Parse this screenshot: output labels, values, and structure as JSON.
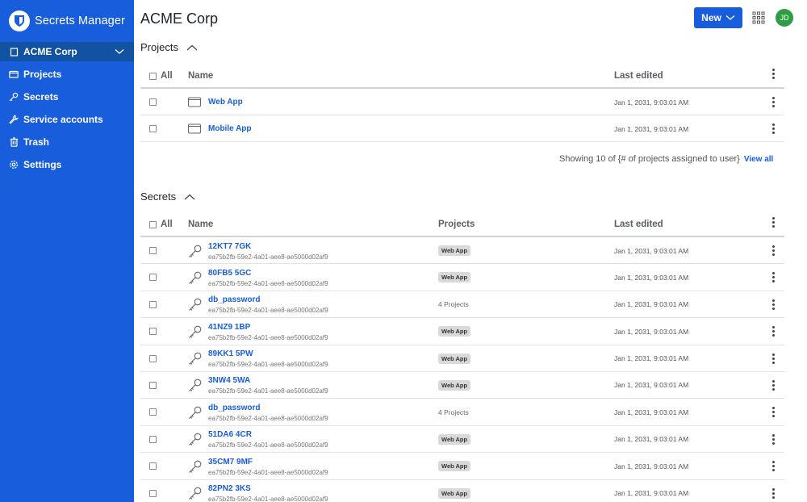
{
  "sidebar": {
    "brand": "Secrets Manager",
    "org": "ACME Corp",
    "nav": [
      {
        "label": "Projects",
        "icon": "folder-icon"
      },
      {
        "label": "Secrets",
        "icon": "key-icon"
      },
      {
        "label": "Service accounts",
        "icon": "wrench-icon"
      },
      {
        "label": "Trash",
        "icon": "trash-icon"
      },
      {
        "label": "Settings",
        "icon": "gear-icon"
      }
    ]
  },
  "header": {
    "title": "ACME Corp",
    "new_label": "New",
    "avatar": "JD"
  },
  "projects": {
    "heading": "Projects",
    "columns": {
      "all": "All",
      "name": "Name",
      "last_edited": "Last edited"
    },
    "rows": [
      {
        "name": "Web App",
        "date": "Jan 1, 2031, 9:03:01 AM"
      },
      {
        "name": "Mobile App",
        "date": "Jan 1, 2031, 9:03:01 AM"
      }
    ],
    "showing": "Showing 10 of {# of projects assigned to user}",
    "view_all": "View all"
  },
  "secrets": {
    "heading": "Secrets",
    "columns": {
      "all": "All",
      "name": "Name",
      "projects": "Projects",
      "last_edited": "Last edited"
    },
    "rows": [
      {
        "name": "12KT7 7GK",
        "id": "ea75b2fb-59e2-4a01-aee8-ae5000d02af9",
        "project": "Web App",
        "project_badge": true,
        "date": "Jan 1, 2031, 9:03:01 AM"
      },
      {
        "name": "80FB5 5GC",
        "id": "ea75b2fb-59e2-4a01-aee8-ae5000d02af9",
        "project": "Web App",
        "project_badge": true,
        "date": "Jan 1, 2031, 9:03:01 AM"
      },
      {
        "name": "db_password",
        "id": "ea75b2fb-59e2-4a01-aee8-ae5000d02af9",
        "project": "4 Projects",
        "project_badge": false,
        "date": "Jan 1, 2031, 9:03:01 AM"
      },
      {
        "name": "41NZ9 1BP",
        "id": "ea75b2fb-59e2-4a01-aee8-ae5000d02af9",
        "project": "Web App",
        "project_badge": true,
        "date": "Jan 1, 2031, 9:03:01 AM"
      },
      {
        "name": "89KK1 5PW",
        "id": "ea75b2fb-59e2-4a01-aee8-ae5000d02af9",
        "project": "Web App",
        "project_badge": true,
        "date": "Jan 1, 2031, 9:03:01 AM"
      },
      {
        "name": "3NW4 5WA",
        "id": "ea75b2fb-59e2-4a01-aee8-ae5000d02af9",
        "project": "Web App",
        "project_badge": true,
        "date": "Jan 1, 2031, 9:03:01 AM"
      },
      {
        "name": "db_password",
        "id": "ea75b2fb-59e2-4a01-aee8-ae5000d02af9",
        "project": "4 Projects",
        "project_badge": false,
        "date": "Jan 1, 2031, 9:03:01 AM"
      },
      {
        "name": "51DA6 4CR",
        "id": "ea75b2fb-59e2-4a01-aee8-ae5000d02af9",
        "project": "Web App",
        "project_badge": true,
        "date": "Jan 1, 2031, 9:03:01 AM"
      },
      {
        "name": "35CM7 9MF",
        "id": "ea75b2fb-59e2-4a01-aee8-ae5000d02af9",
        "project": "Web App",
        "project_badge": true,
        "date": "Jan 1, 2031, 9:03:01 AM"
      },
      {
        "name": "82PN2 3KS",
        "id": "ea75b2fb-59e2-4a01-aee8-ae5000d02af9",
        "project": "Web App",
        "project_badge": true,
        "date": "Jan 1, 2031, 9:03:01 AM"
      }
    ]
  },
  "colors": {
    "brand": "#175ddc",
    "org_bar": "#1252a3",
    "avatar": "#2e9e44"
  }
}
